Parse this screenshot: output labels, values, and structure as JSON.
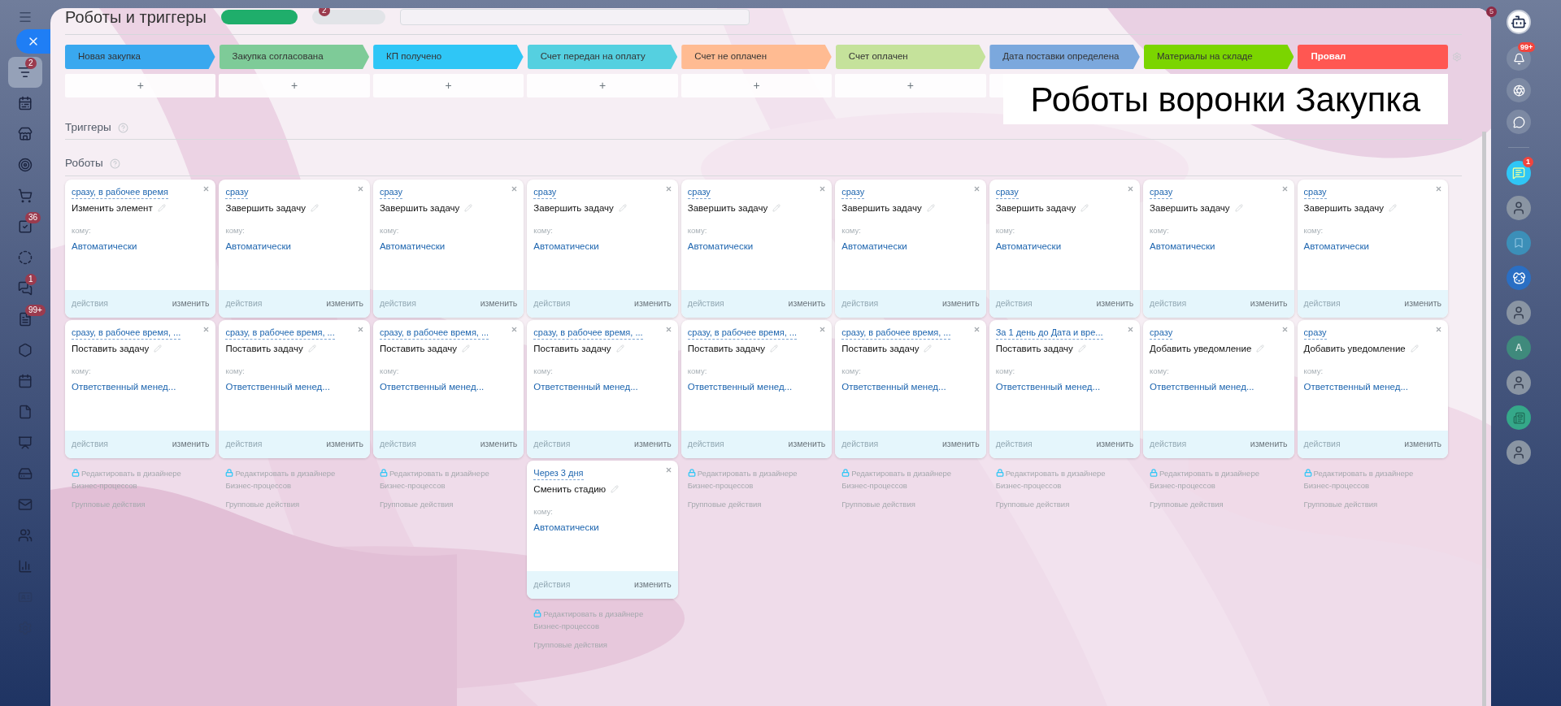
{
  "left_sidebar": {
    "items": [
      {
        "selected": true,
        "badge": "2"
      },
      {
        "selected": false
      },
      {
        "selected": false
      },
      {
        "selected": false
      },
      {
        "selected": false
      },
      {
        "selected": false,
        "badge": "36"
      },
      {
        "selected": false
      },
      {
        "selected": false,
        "badge": "1"
      },
      {
        "selected": false,
        "badge": "99+"
      },
      {
        "selected": false
      },
      {
        "selected": false
      },
      {
        "selected": false
      },
      {
        "selected": false
      },
      {
        "selected": false
      },
      {
        "selected": false
      },
      {
        "selected": false
      },
      {
        "selected": false
      },
      {
        "selected": false
      },
      {
        "selected": false
      }
    ]
  },
  "header": {
    "title": "Роботы и триггеры",
    "counter_badge": "2"
  },
  "stages": [
    {
      "label": "Новая закупка",
      "color": "#39a8ef",
      "kind": "stage"
    },
    {
      "label": "Закупка согласована",
      "color": "#7ecb98",
      "kind": "stage"
    },
    {
      "label": "КП получено",
      "color": "#2fc6f6",
      "kind": "stage"
    },
    {
      "label": "Счет передан на оплату",
      "color": "#55d0e0",
      "kind": "stage"
    },
    {
      "label": "Счет не оплачен",
      "color": "#ffbb92",
      "kind": "stage"
    },
    {
      "label": "Счет оплачен",
      "color": "#c5e29b",
      "kind": "stage"
    },
    {
      "label": "Дата поставки определена",
      "color": "#7ba8dd",
      "kind": "stage"
    },
    {
      "label": "Материалы на складе",
      "color": "#7bd500",
      "kind": "stage"
    },
    {
      "label": "Провал",
      "color": "#ff5752",
      "kind": "fail"
    }
  ],
  "add_buttons": [
    "+",
    "+",
    "+",
    "+",
    "+",
    "+"
  ],
  "banner": "Роботы воронки Закупка",
  "triggers_heading": "Триггеры",
  "robots_heading": "Роботы",
  "columns": [
    {
      "robots": [
        {
          "delay": "сразу, в рабочее время",
          "action": "Изменить элемент",
          "to_label": "кому:",
          "to": "Автоматически",
          "actions": "действия",
          "edit": "изменить"
        },
        {
          "delay": "сразу, в рабочее время, ...",
          "action": "Поставить задачу",
          "to_label": "кому:",
          "to": "Ответственный менед...",
          "actions": "действия",
          "edit": "изменить"
        }
      ],
      "designer_link": "Редактировать в дизайнере Бизнес-процессов",
      "group_actions": "Групповые действия"
    },
    {
      "robots": [
        {
          "delay": "сразу",
          "action": "Завершить задачу",
          "to_label": "кому:",
          "to": "Автоматически",
          "actions": "действия",
          "edit": "изменить"
        },
        {
          "delay": "сразу, в рабочее время, ...",
          "action": "Поставить задачу",
          "to_label": "кому:",
          "to": "Ответственный менед...",
          "actions": "действия",
          "edit": "изменить"
        }
      ],
      "designer_link": "Редактировать в дизайнере Бизнес-процессов",
      "group_actions": "Групповые действия"
    },
    {
      "robots": [
        {
          "delay": "сразу",
          "action": "Завершить задачу",
          "to_label": "кому:",
          "to": "Автоматически",
          "actions": "действия",
          "edit": "изменить"
        },
        {
          "delay": "сразу, в рабочее время, ...",
          "action": "Поставить задачу",
          "to_label": "кому:",
          "to": "Ответственный менед...",
          "actions": "действия",
          "edit": "изменить"
        }
      ],
      "designer_link": "Редактировать в дизайнере Бизнес-процессов",
      "group_actions": "Групповые действия"
    },
    {
      "robots": [
        {
          "delay": "сразу",
          "action": "Завершить задачу",
          "to_label": "кому:",
          "to": "Автоматически",
          "actions": "действия",
          "edit": "изменить"
        },
        {
          "delay": "сразу, в рабочее время, ...",
          "action": "Поставить задачу",
          "to_label": "кому:",
          "to": "Ответственный менед...",
          "actions": "действия",
          "edit": "изменить"
        },
        {
          "delay": "Через 3 дня",
          "action": "Сменить стадию",
          "to_label": "кому:",
          "to": "Автоматически",
          "actions": "действия",
          "edit": "изменить"
        }
      ],
      "designer_link": "Редактировать в дизайнере Бизнес-процессов",
      "group_actions": "Групповые действия"
    },
    {
      "robots": [
        {
          "delay": "сразу",
          "action": "Завершить задачу",
          "to_label": "кому:",
          "to": "Автоматически",
          "actions": "действия",
          "edit": "изменить"
        },
        {
          "delay": "сразу, в рабочее время, ...",
          "action": "Поставить задачу",
          "to_label": "кому:",
          "to": "Ответственный менед...",
          "actions": "действия",
          "edit": "изменить"
        }
      ],
      "designer_link": "Редактировать в дизайнере Бизнес-процессов",
      "group_actions": "Групповые действия"
    },
    {
      "robots": [
        {
          "delay": "сразу",
          "action": "Завершить задачу",
          "to_label": "кому:",
          "to": "Автоматически",
          "actions": "действия",
          "edit": "изменить"
        },
        {
          "delay": "сразу, в рабочее время, ...",
          "action": "Поставить задачу",
          "to_label": "кому:",
          "to": "Ответственный менед...",
          "actions": "действия",
          "edit": "изменить"
        }
      ],
      "designer_link": "Редактировать в дизайнере Бизнес-процессов",
      "group_actions": "Групповые действия"
    },
    {
      "robots": [
        {
          "delay": "сразу",
          "action": "Завершить задачу",
          "to_label": "кому:",
          "to": "Автоматически",
          "actions": "действия",
          "edit": "изменить"
        },
        {
          "delay": "За 1 день до Дата и вре...",
          "action": "Поставить задачу",
          "to_label": "кому:",
          "to": "Ответственный менед...",
          "actions": "действия",
          "edit": "изменить"
        }
      ],
      "designer_link": "Редактировать в дизайнере Бизнес-процессов",
      "group_actions": "Групповые действия"
    },
    {
      "robots": [
        {
          "delay": "сразу",
          "action": "Завершить задачу",
          "to_label": "кому:",
          "to": "Автоматически",
          "actions": "действия",
          "edit": "изменить"
        },
        {
          "delay": "сразу",
          "action": "Добавить уведомление",
          "to_label": "кому:",
          "to": "Ответственный менед...",
          "actions": "действия",
          "edit": "изменить"
        }
      ],
      "designer_link": "Редактировать в дизайнере Бизнес-процессов",
      "group_actions": "Групповые действия"
    },
    {
      "robots": [
        {
          "delay": "сразу",
          "action": "Завершить задачу",
          "to_label": "кому:",
          "to": "Автоматически",
          "actions": "действия",
          "edit": "изменить"
        },
        {
          "delay": "сразу",
          "action": "Добавить уведомление",
          "to_label": "кому:",
          "to": "Ответственный менед...",
          "actions": "действия",
          "edit": "изменить"
        }
      ],
      "designer_link": "Редактировать в дизайнере Бизнес-процессов",
      "group_actions": "Групповые действия"
    }
  ],
  "right_sidebar": {
    "corner_badge": "5",
    "notifications_badge": "99+",
    "contacts": [
      {
        "kind": "chat",
        "badge": "1"
      },
      {
        "kind": "person"
      },
      {
        "kind": "bookmark"
      },
      {
        "kind": "dog"
      },
      {
        "kind": "person"
      },
      {
        "kind": "letter",
        "letter": "A"
      },
      {
        "kind": "person"
      },
      {
        "kind": "news"
      },
      {
        "kind": "person"
      }
    ]
  }
}
